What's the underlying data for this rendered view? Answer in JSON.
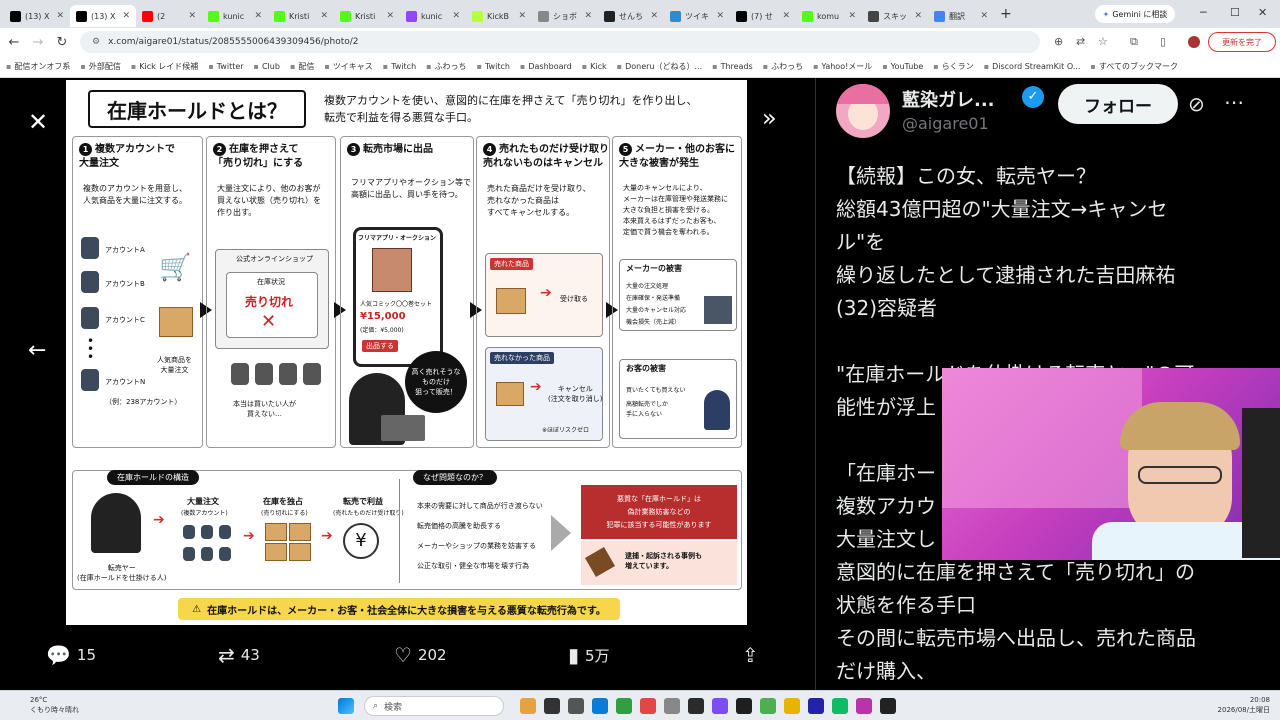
{
  "browser": {
    "tabs": [
      {
        "label": "(13) X",
        "icon": "x-logo",
        "color": "#000000"
      },
      {
        "label": "(13) X",
        "icon": "x-logo",
        "color": "#000000",
        "active": true
      },
      {
        "label": "(2",
        "icon": "youtube-logo",
        "color": "#ff0000"
      },
      {
        "label": "kunic",
        "icon": "kick-logo",
        "color": "#53fc18"
      },
      {
        "label": "Kristi",
        "icon": "kick-logo",
        "color": "#53fc18"
      },
      {
        "label": "Kristi",
        "icon": "kick-logo",
        "color": "#53fc18"
      },
      {
        "label": "kunic",
        "icon": "twitch-logo",
        "color": "#9146ff"
      },
      {
        "label": "KickB",
        "icon": "kickbot-logo",
        "color": "#b6ff3b"
      },
      {
        "label": "ショボ",
        "icon": "page-icon",
        "color": "#888888"
      },
      {
        "label": "せんち",
        "icon": "chat-logo",
        "color": "#222222"
      },
      {
        "label": "ツイキ",
        "icon": "twicas-logo",
        "color": "#2a8bd6"
      },
      {
        "label": "(7) せ",
        "icon": "x-logo",
        "color": "#000000"
      },
      {
        "label": "komu",
        "icon": "kick-logo",
        "color": "#53fc18"
      },
      {
        "label": "スキッ",
        "icon": "page-icon",
        "color": "#444444"
      },
      {
        "label": "翻訳",
        "icon": "google-logo",
        "color": "#4285f4"
      }
    ],
    "new_tab": "+",
    "gemini": "Gemini に相談",
    "url": "x.com/aigare01/status/2085555006439309456/photo/2",
    "update_button": "更新を完了",
    "bookmarks": [
      "配信オンオフ系",
      "外部配信",
      "Kick レイド候補",
      "Twitter",
      "Club",
      "配信",
      "ツイキャス",
      "Twitch",
      "ふわっち",
      "Twitch",
      "Dashboard",
      "Kick",
      "Doneru（どねる）...",
      "Threads",
      "ふわっち",
      "Yahoo!メール",
      "YouTube",
      "らくラン",
      "Discord StreamKit O...",
      "すべてのブックマーク"
    ]
  },
  "infographic": {
    "title": "在庫ホールドとは？",
    "subtitle_line1": "複数アカウントを使い、意図的に在庫を押さえて「売り切れ」を作り出し、",
    "subtitle_line2": "転売で利益を得る悪質な手口。",
    "steps": [
      {
        "num": "1",
        "heading": "複数アカウントで\n大量注文",
        "desc": "複数のアカウントを用意し、\n人気商品を大量に注文する。"
      },
      {
        "num": "2",
        "heading": "在庫を押さえて\n「売り切れ」にする",
        "desc": "大量注文により、他のお客が\n買えない状態（売り切れ）を\n作り出す。"
      },
      {
        "num": "3",
        "heading": "転売市場に出品",
        "desc": "フリマアプリやオークション等で\n高額に出品し、買い手を待つ。"
      },
      {
        "num": "4",
        "heading": "売れたものだけ受け取り\n売れないものはキャンセル",
        "desc": "売れた商品だけを受け取り、\n売れなかった商品は\nすべてキャンセルする。"
      },
      {
        "num": "5",
        "heading": "メーカー・他のお客に\n大きな被害が発生",
        "desc": "大量のキャンセルにより、\nメーカーは在庫管理や発送業務に\n大きな負担と損害を受ける。\n本来買えるはずだったお客も、\n定価で買う機会を奪われる。"
      }
    ],
    "accounts": [
      "アカウントA",
      "アカウントB",
      "アカウントC",
      "アカウントN"
    ],
    "accounts_example": "（例：238アカウント）",
    "popular_item": "人気商品を\n大量注文",
    "shop_name": "公式オンラインショップ",
    "stock_status": "在庫状況",
    "sold_out": "売り切れ",
    "buyers_note": "本当は買いたい人が\n買えない…",
    "flea_app": "フリマアプリ・オークション",
    "listing_name": "人気コミック〇〇巻セット",
    "listing_price": "¥15,000",
    "listing_list_price": "(定価：¥5,000)",
    "listing_button": "出品する",
    "reseller_bubble": "高く売れそうな\nものだけ\n狙って販売！",
    "sold_tag": "売れた商品",
    "receive": "受け取る",
    "unsold_tag": "売れなかった商品",
    "cancel": "キャンセル\n(注文を取り消し)",
    "risk_zero": "※ほぼリスクゼロ",
    "maker_damage_title": "メーカーの被害",
    "maker_damage": [
      "大量の注文処理",
      "在庫確保・発送準備",
      "大量のキャンセル対応",
      "機会損失（売上減）"
    ],
    "customer_damage_title": "お客の被害",
    "customer_damage": [
      "買いたくても買えない",
      "高額転売でしか\n手に入らない"
    ],
    "structure_title": "在庫ホールドの構造",
    "structure": [
      {
        "h": "大量注文",
        "s": "(複数アカウント)"
      },
      {
        "h": "在庫を独占",
        "s": "(売り切れにする)"
      },
      {
        "h": "転売で利益",
        "s": "(売れたものだけ受け取り)"
      }
    ],
    "reseller_label": "転売ヤー\n(在庫ホールドを仕掛ける人)",
    "why_title": "なぜ問題なのか？",
    "why": [
      "本来の需要に対して商品が行き渡らない",
      "転売価格の高騰を助長する",
      "メーカーやショップの業務を妨害する",
      "公正な取引・健全な市場を壊す行為"
    ],
    "crime_box": "悪質な「在庫ホールド」は\n偽計業務妨害などの\n犯罪に該当する可能性があります",
    "arrest": "逮捕・起訴される事例も\n増えています。",
    "warning": "在庫ホールドは、メーカー・お客・社会全体に大きな損害を与える悪質な転売行為です。"
  },
  "actions": {
    "replies": "15",
    "reposts": "43",
    "likes": "202",
    "views": "5万"
  },
  "profile": {
    "name": "藍染ガレ...",
    "handle": "@aigare01",
    "follow": "フォロー"
  },
  "tweet_text": "【続報】この女、転売ヤー？\n総額43億円超の\"大量注文→キャンセ\nル\"を\n繰り返したとして逮捕された吉田麻祐\n(32)容疑者\n\n\"在庫ホールドを仕掛ける転売ヤー\"の可\n能性が浮上\n\n「在庫ホー\n複数アカウ\n大量注文し\n意図的に在庫を押さえて「売り切れ」の\n状態を作る手口\nその間に転売市場へ出品し、売れた商品\nだけ購入、\nそれ以外はキャンセルすることで",
  "taskbar": {
    "weather_temp": "26°C",
    "weather_desc": "くもり時々晴れ",
    "search": "検索",
    "time": "20:08",
    "date": "2026/08/土曜日"
  }
}
